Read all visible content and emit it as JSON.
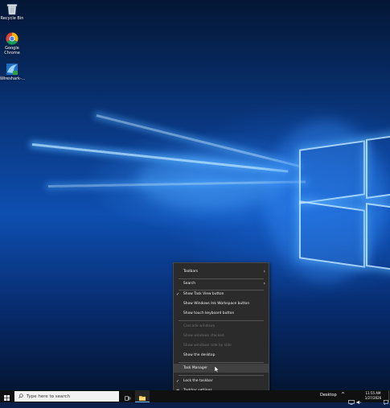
{
  "desktop_icons": [
    {
      "label": "Recycle Bin",
      "icon": "recycle-bin-icon"
    },
    {
      "label": "Google Chrome",
      "icon": "chrome-icon"
    },
    {
      "label": "Wireshark-...",
      "icon": "wireshark-icon"
    }
  ],
  "context_menu": {
    "items": [
      {
        "label": "Toolbars",
        "checked": false,
        "disabled": false,
        "submenu": true
      },
      {
        "label": "Search",
        "checked": false,
        "disabled": false,
        "submenu": true
      },
      {
        "label": "Show Task View button",
        "checked": true,
        "disabled": false
      },
      {
        "label": "Show Windows Ink Workspace button",
        "checked": false,
        "disabled": false
      },
      {
        "label": "Show touch keyboard button",
        "checked": false,
        "disabled": false
      },
      {
        "label": "Cascade windows",
        "checked": false,
        "disabled": true
      },
      {
        "label": "Show windows stacked",
        "checked": false,
        "disabled": true
      },
      {
        "label": "Show windows side by side",
        "checked": false,
        "disabled": true
      },
      {
        "label": "Show the desktop",
        "checked": false,
        "disabled": false
      },
      {
        "label": "Task Manager",
        "checked": false,
        "disabled": false,
        "hovered": true
      },
      {
        "label": "Lock the taskbar",
        "checked": true,
        "disabled": false
      },
      {
        "label": "Taskbar settings",
        "checked": false,
        "disabled": false,
        "icon": "gear-icon"
      }
    ]
  },
  "taskbar": {
    "search_placeholder": "Type here to search",
    "desktop_label": "Desktop",
    "time": "11:55 AM",
    "date": "1/27/2026",
    "icons": [
      "windows-start-icon",
      "task-view-icon",
      "file-explorer-icon"
    ]
  },
  "colors": {
    "menu_bg": "#2b2b2b",
    "menu_hover": "#414141",
    "taskbar_bg": "#101010",
    "desktop_blue": "#0e4fb1"
  }
}
